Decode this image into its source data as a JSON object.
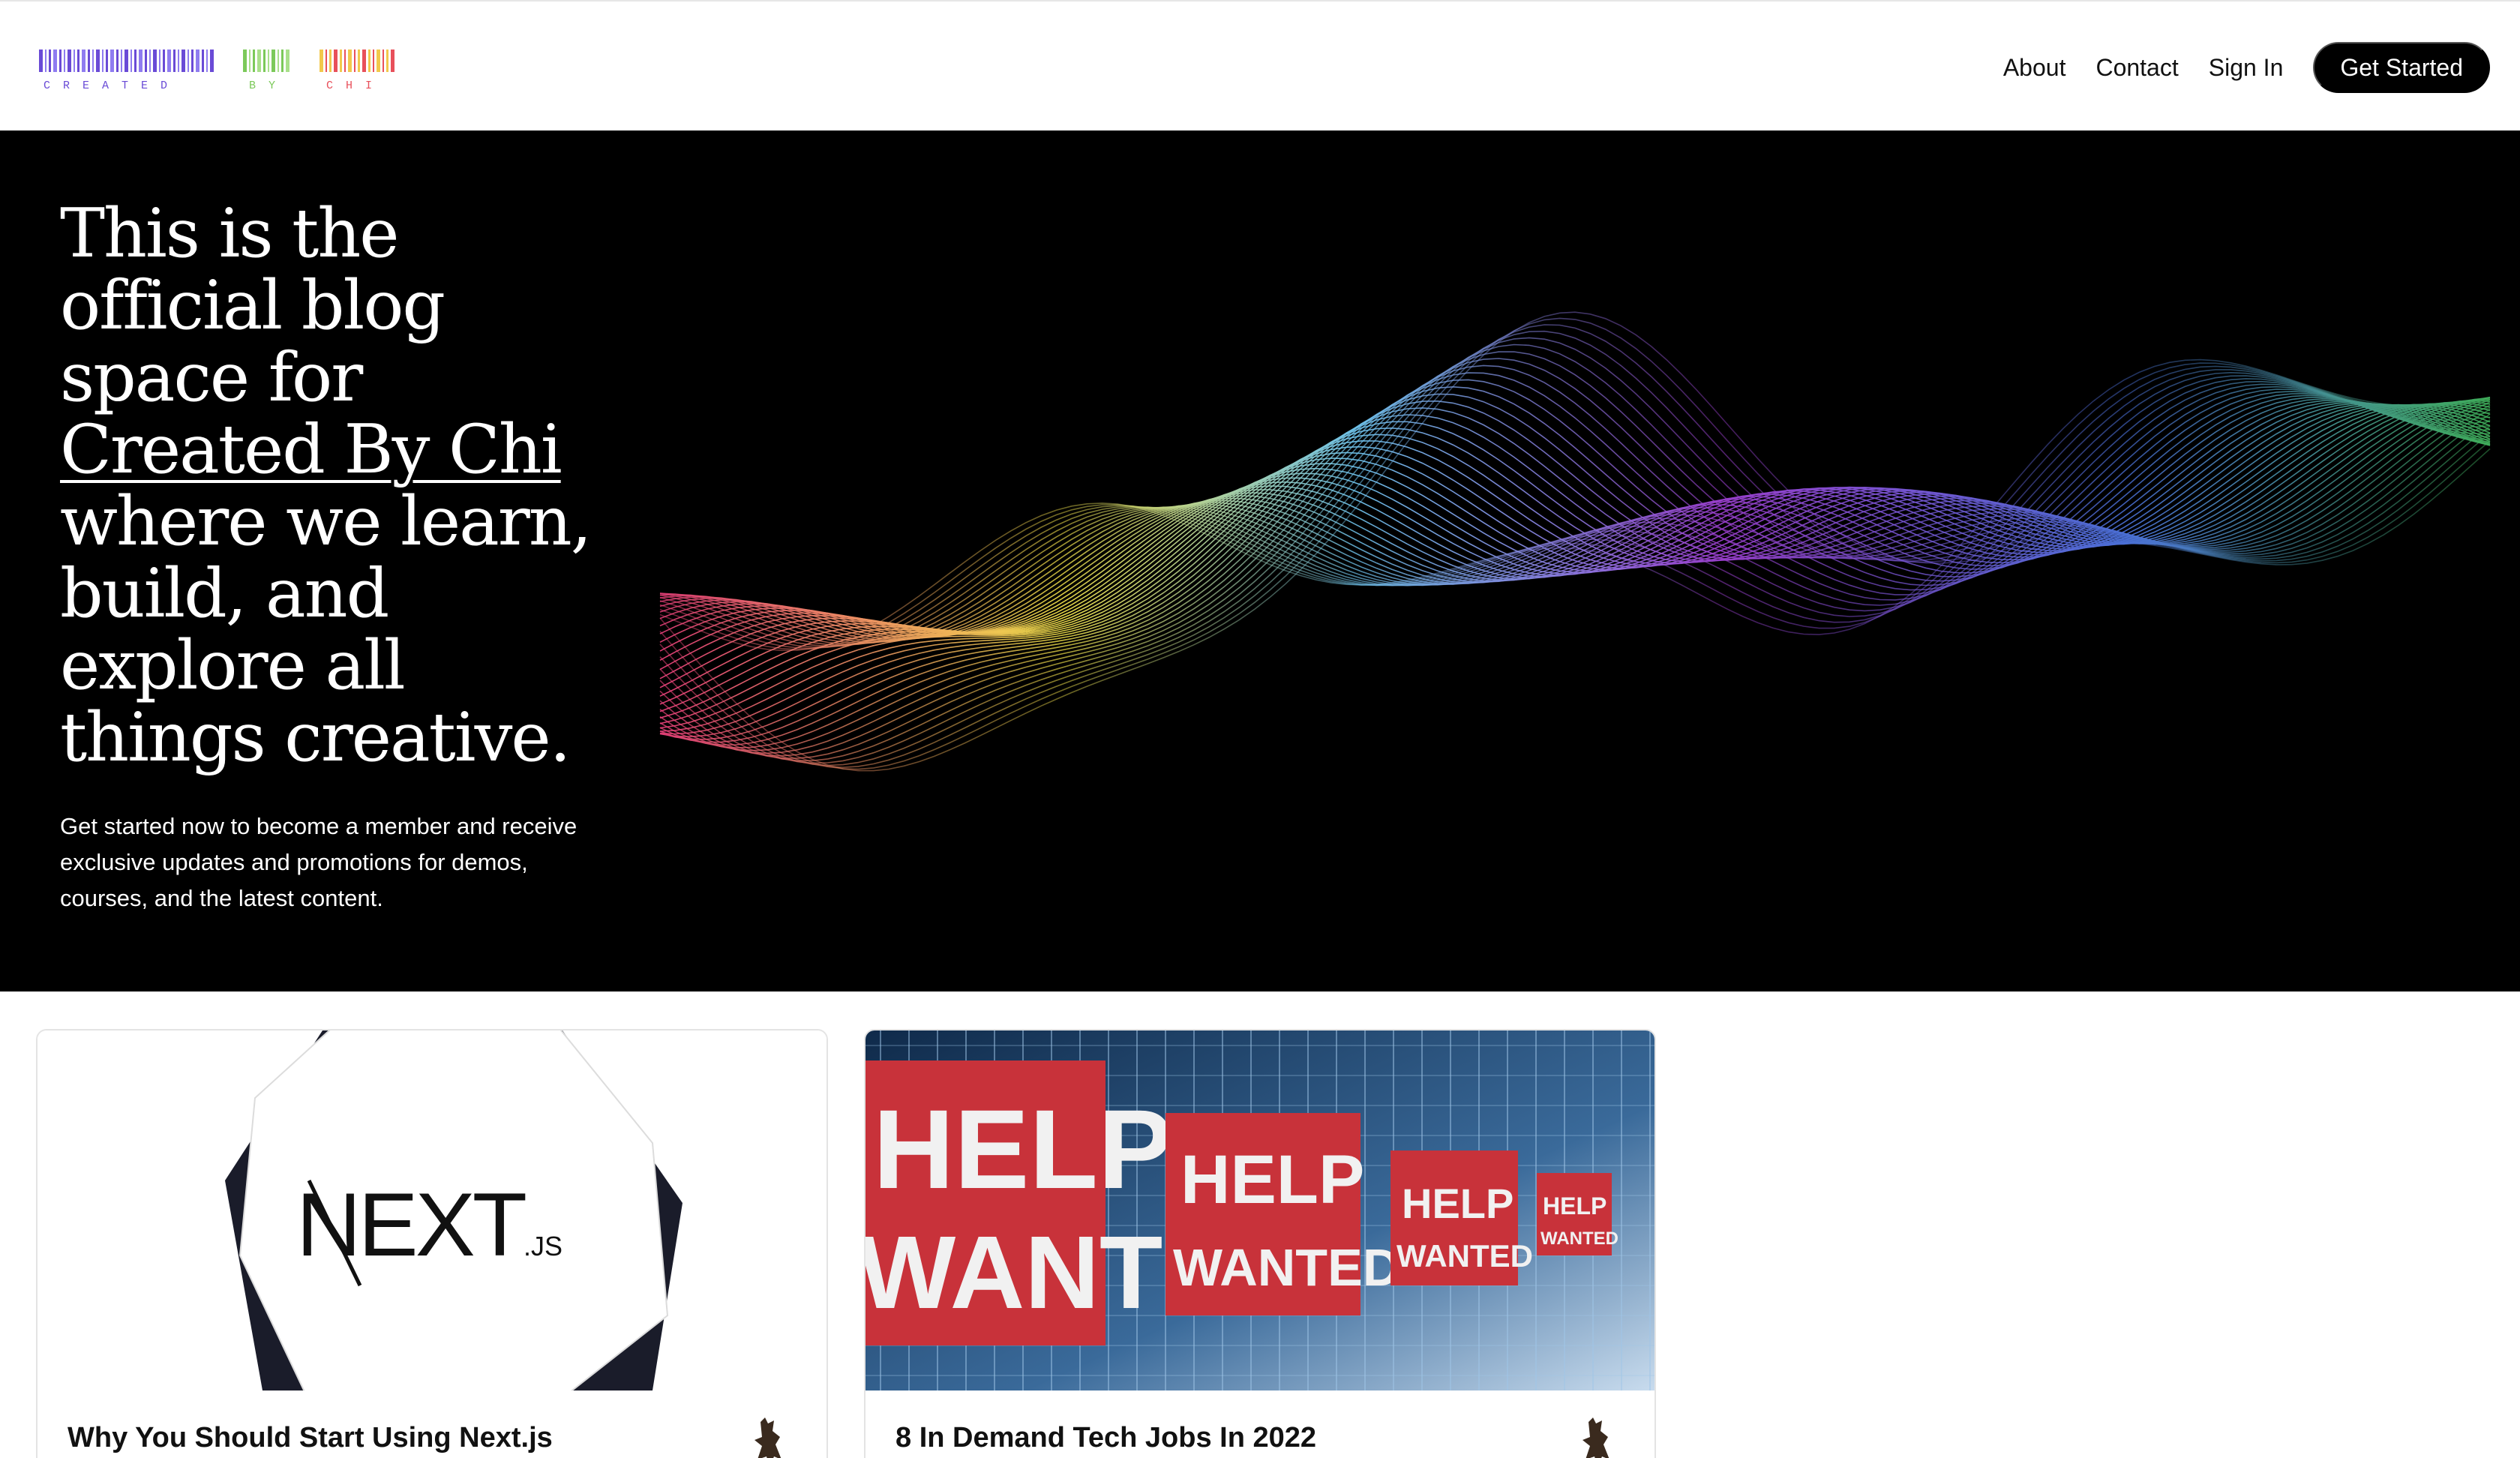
{
  "header": {
    "logo": {
      "word1": "CREATED",
      "word2": "BY",
      "word3": "CHI",
      "colors": {
        "word1": "#6a4bd6",
        "word2": "#7cc95a",
        "word3_start": "#f2c94c",
        "word3_end": "#e8505b"
      }
    },
    "nav": {
      "about": "About",
      "contact": "Contact",
      "sign_in": "Sign In",
      "get_started": "Get Started"
    }
  },
  "hero": {
    "title_before": "This is the official blog space for",
    "title_brand": "Created By Chi",
    "title_after": "where we learn, build, and explore all things creative.",
    "subtitle": "Get started now to become a member and receive exclusive updates and promotions for demos, courses, and the latest content.",
    "background": "#000000",
    "wave_colors": [
      "#e8407a",
      "#f0e04a",
      "#6fc3ec",
      "#9b3fcf",
      "#4a6fd6",
      "#3fae5a"
    ]
  },
  "cards": [
    {
      "title": "Why You Should Start Using Next.js",
      "image_icon": "nextjs-logo-icon",
      "image_text_main": "NEXT",
      "image_text_sub": ".JS",
      "avatar_icon": "author-avatar-icon"
    },
    {
      "title": "8 In Demand Tech Jobs In 2022",
      "image_icon": "help-wanted-server-room-image",
      "image_signs": [
        {
          "line1": "HELP",
          "line2": "WANTED"
        },
        {
          "line1": "HELP",
          "line2": "WANTED"
        },
        {
          "line1": "HELP",
          "line2": "WANTED"
        },
        {
          "line1": "HELP",
          "line2": "WANTED"
        }
      ],
      "avatar_icon": "author-avatar-icon"
    }
  ]
}
